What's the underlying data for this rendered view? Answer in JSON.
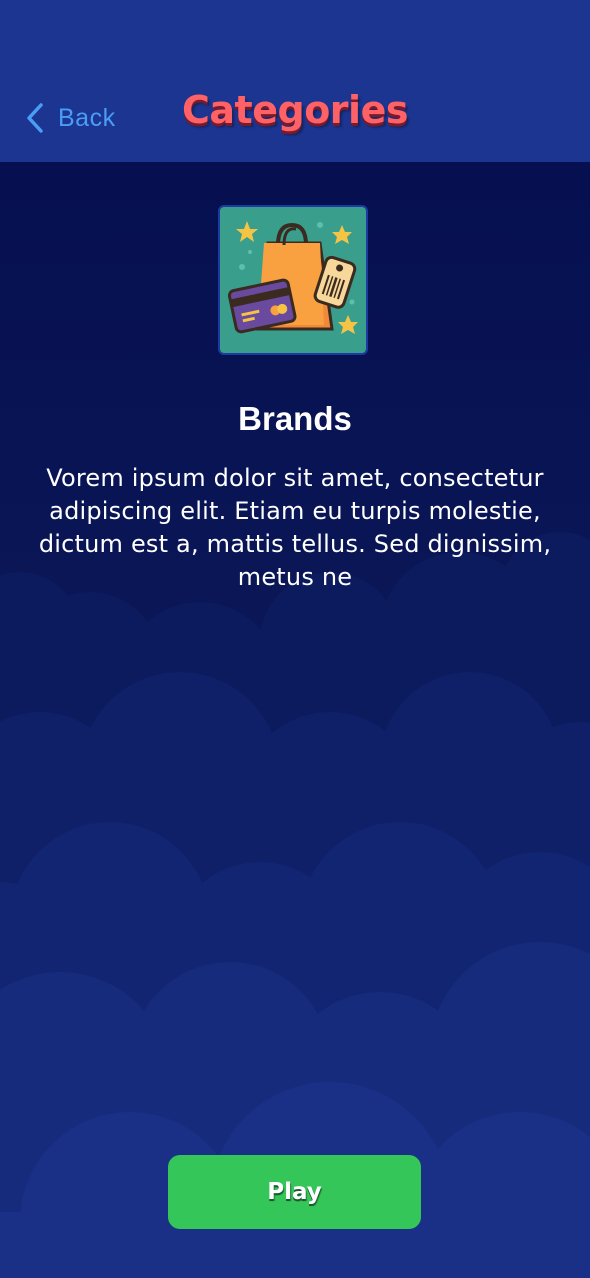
{
  "header": {
    "back_label": "Back",
    "title": "Categories",
    "back_icon": "chevron-left-icon"
  },
  "category": {
    "icon": "shopping-bag-icon",
    "name": "Brands",
    "description": "Vorem ipsum dolor sit amet, consectetur adipiscing elit. Etiam eu turpis molestie, dictum est a, mattis tellus. Sed dignissim, metus ne"
  },
  "actions": {
    "play_label": "Play"
  },
  "colors": {
    "header_bg": "#1b3590",
    "title": "#ff6266",
    "back_text": "#4a9cf5",
    "background": "#0a1450",
    "play_button": "#34c659"
  }
}
